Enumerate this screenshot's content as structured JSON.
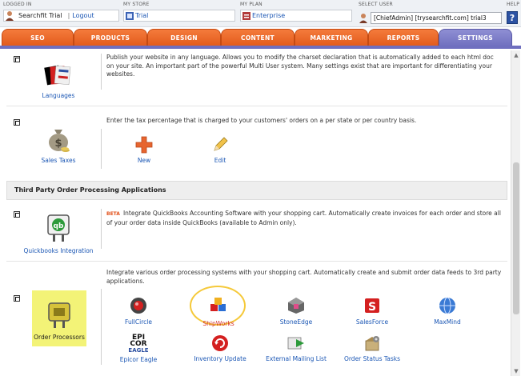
{
  "topbar": {
    "logged_in_label": "LOGGED IN",
    "user_name": "Searchfit Trial",
    "logout_link": "Logout",
    "my_store_label": "MY STORE",
    "store_name": "Trial",
    "my_plan_label": "MY PLAN",
    "plan_name": "Enterprise",
    "select_user_label": "SELECT USER",
    "selected_user": "[ChiefAdmin] [trysearchfit.com] trial3",
    "help_label": "HELP",
    "help_glyph": "?"
  },
  "tabs": [
    {
      "label": "SEO"
    },
    {
      "label": "PRODUCTS"
    },
    {
      "label": "DESIGN"
    },
    {
      "label": "CONTENT"
    },
    {
      "label": "MARKETING"
    },
    {
      "label": "REPORTS"
    },
    {
      "label": "SETTINGS"
    }
  ],
  "rows": {
    "languages": {
      "label": "Languages",
      "description": "Publish your website in any language. Allows you to modify the charset declaration that is automatically added to each html doc on your site. An important part of the powerful Multi User system. Many settings exist that are important for differentiating your websites."
    },
    "sales_taxes": {
      "label": "Sales Taxes",
      "description": "Enter the tax percentage that is charged to your customers' orders on a per state or per country basis.",
      "actions": [
        {
          "label": "New"
        },
        {
          "label": "Edit"
        }
      ]
    },
    "section_header": "Third Party Order Processing Applications",
    "quickbooks": {
      "label": "Quickbooks Integration",
      "badge": "BETA",
      "description": "Integrate QuickBooks Accounting Software with your shopping cart. Automatically create invoices for each order and store all of your order data inside QuickBooks (available to Admin only)."
    },
    "order_processors": {
      "label": "Order Processors",
      "description": "Integrate various order processing systems with your shopping cart. Automatically create and submit order data feeds to 3rd party applications.",
      "items": [
        {
          "label": "FullCircle"
        },
        {
          "label": "ShipWorks"
        },
        {
          "label": "StoneEdge"
        },
        {
          "label": "SalesForce"
        },
        {
          "label": "MaxMind"
        },
        {
          "label": "Epicor Eagle"
        },
        {
          "label": "Inventory Update"
        },
        {
          "label": "External Mailing List"
        },
        {
          "label": "Order Status Tasks"
        }
      ]
    }
  },
  "colors": {
    "tab_orange": "#e25a1b",
    "tab_active": "#6f6fbf",
    "link_blue": "#1a56b4",
    "highlight_yellow": "#f3f377"
  }
}
